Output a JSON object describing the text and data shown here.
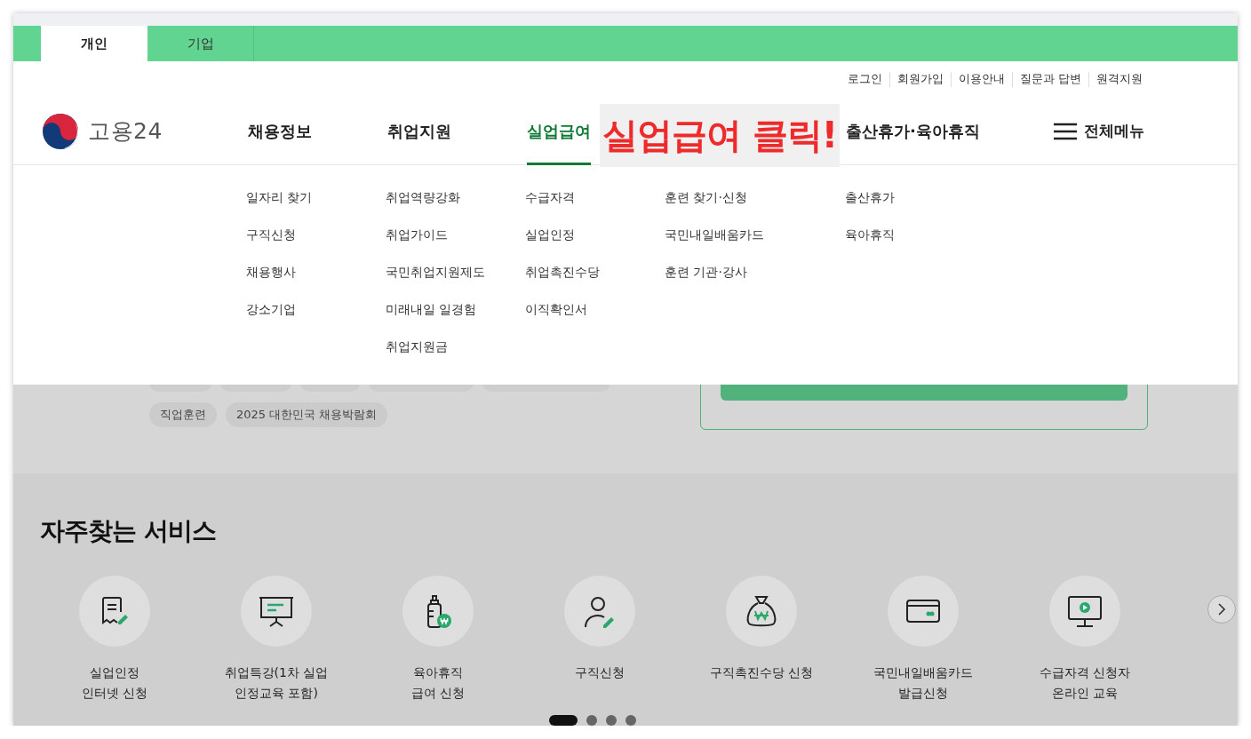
{
  "audience_tabs": [
    {
      "label": "개인",
      "selected": true
    },
    {
      "label": "기업",
      "selected": false
    }
  ],
  "utility_links": [
    "로그인",
    "회원가입",
    "이용안내",
    "질문과 답변",
    "원격지원"
  ],
  "logo": {
    "text": "고용24"
  },
  "main_nav": [
    {
      "label": "채용정보",
      "selected": false
    },
    {
      "label": "취업지원",
      "selected": false
    },
    {
      "label": "실업급여",
      "selected": true
    },
    {
      "label": "출산휴가·육아휴직",
      "selected": false
    }
  ],
  "all_menu": {
    "label": "전체메뉴"
  },
  "annotation": "실업급여 클릭!",
  "mega_menu": [
    [
      "일자리 찾기",
      "구직신청",
      "채용행사",
      "강소기업"
    ],
    [
      "취업역량강화",
      "취업가이드",
      "국민취업지원제도",
      "미래내일 일경험",
      "취업지원금"
    ],
    [
      "수급자격",
      "실업인정",
      "취업촉진수당",
      "이직확인서"
    ],
    [
      "훈련 찾기·신청",
      "국민내일배움카드",
      "훈련 기관·강사"
    ],
    [
      "출산휴가",
      "육아휴직"
    ]
  ],
  "tags": [
    "직업훈련",
    "2025 대한민국 채용박람회"
  ],
  "services": {
    "title": "자주찾는 서비스",
    "items": [
      {
        "kind": "document",
        "label": "실업인정\n인터넷 신청"
      },
      {
        "kind": "presentation",
        "label": "취업특강(1차 실업\n인정교육 포함)"
      },
      {
        "kind": "bottle",
        "label": "육아휴직\n급여 신청"
      },
      {
        "kind": "person",
        "label": "구직신청"
      },
      {
        "kind": "moneybag",
        "label": "구직촉진수당 신청"
      },
      {
        "kind": "card",
        "label": "국민내일배움카드\n발급신청"
      },
      {
        "kind": "monitor",
        "label": "수급자격 신청자\n온라인 교육"
      }
    ]
  },
  "pager": [
    {
      "selected": true
    },
    {
      "selected": false
    },
    {
      "selected": false
    },
    {
      "selected": false
    }
  ]
}
